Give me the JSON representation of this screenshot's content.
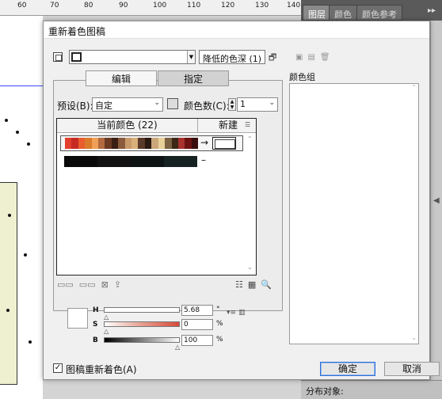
{
  "ruler": {
    "ticks": [
      "60",
      "70",
      "80",
      "90",
      "100",
      "110",
      "120",
      "130",
      "140"
    ]
  },
  "right_panel": {
    "tabs": [
      "图层",
      "颜色",
      "颜色参考"
    ],
    "menu_arrow": "▸▸",
    "status_label": "分布对象:"
  },
  "dialog": {
    "title": "重新着色图稿",
    "reduce_label": "降低的色深 (1)",
    "tabs": {
      "edit": "编辑",
      "assign": "指定"
    },
    "preset_label": "预设(B):",
    "preset_value": "自定",
    "colors_label": "颜色数(C):",
    "colors_value": "1",
    "table": {
      "current_header": "当前颜色 (22)",
      "new_header": "新建",
      "row1_colors": [
        "#e23f2f",
        "#c62a22",
        "#e85c2e",
        "#d97a2a",
        "#f0a056",
        "#b46a3f",
        "#6a3a22",
        "#3a1e14",
        "#8a5a3c",
        "#c89a6a",
        "#d8b07a",
        "#5a3a28",
        "#2a1a12",
        "#caa67a",
        "#e8d09a",
        "#7a6242",
        "#3c2616",
        "#a8322e",
        "#6c1212",
        "#3a0e0e"
      ],
      "row2_colors": [
        "#0a0a0a",
        "#121212",
        "#0e1414",
        "#162222"
      ],
      "row1_arrow": "→",
      "row2_dash": "–"
    },
    "hsb": {
      "h_label": "H",
      "h_value": "5.68",
      "h_unit": "°",
      "s_label": "S",
      "s_value": "0",
      "s_unit": "%",
      "b_label": "B",
      "b_value": "100",
      "b_unit": "%"
    },
    "color_groups_label": "颜色组",
    "recolor_label": "图稿重新着色(A)",
    "recolor_checked": "✓",
    "ok_label": "确定",
    "cancel_label": "取消"
  }
}
